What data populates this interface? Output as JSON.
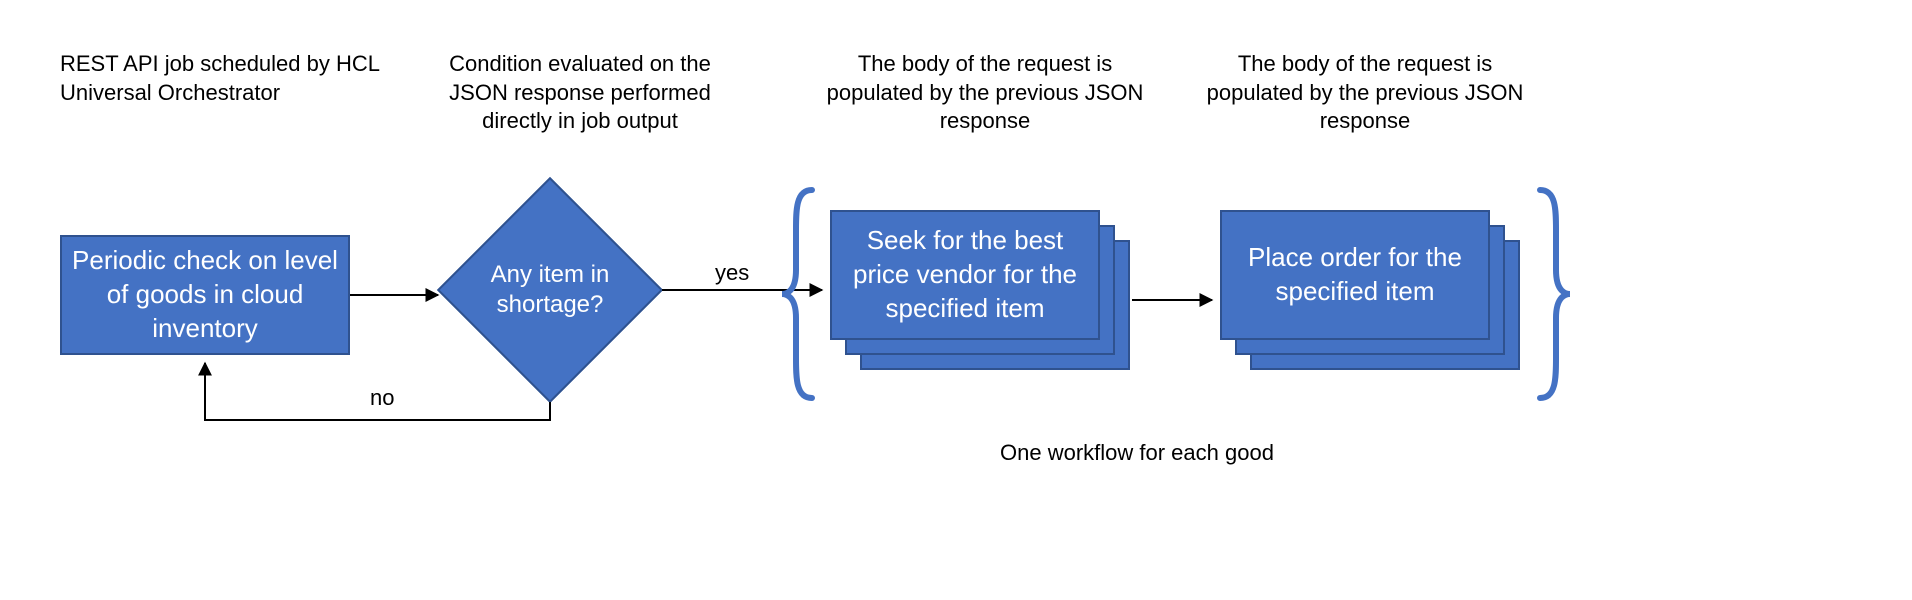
{
  "captions": {
    "c1": "REST API job scheduled by HCL Universal Orchestrator",
    "c2": "Condition evaluated on the JSON response performed directly in job output",
    "c3": "The body of the request is populated by the previous JSON response",
    "c4": "The body of the request is populated by the previous JSON response"
  },
  "nodes": {
    "periodic_check": "Periodic check on level of goods in cloud inventory",
    "decision": "Any item in shortage?",
    "seek_vendor": "Seek for the best price vendor for the specified item",
    "place_order": "Place order for the specified item"
  },
  "edges": {
    "yes": "yes",
    "no": "no"
  },
  "footer": "One workflow for each good",
  "chart_data": {
    "type": "flowchart",
    "nodes": [
      {
        "id": "periodic_check",
        "kind": "process",
        "text": "Periodic check on level of goods in cloud inventory",
        "caption": "REST API job scheduled by HCL Universal Orchestrator"
      },
      {
        "id": "decision",
        "kind": "decision",
        "text": "Any item in shortage?",
        "caption": "Condition evaluated on the JSON response performed directly in job output"
      },
      {
        "id": "seek_vendor",
        "kind": "process_multi",
        "text": "Seek for the best price vendor for the specified item",
        "caption": "The body of the request is populated by the previous JSON response"
      },
      {
        "id": "place_order",
        "kind": "process_multi",
        "text": "Place order for the specified item",
        "caption": "The body of the request is populated by the previous JSON response"
      }
    ],
    "edges": [
      {
        "from": "periodic_check",
        "to": "decision"
      },
      {
        "from": "decision",
        "to": "seek_vendor",
        "label": "yes"
      },
      {
        "from": "decision",
        "to": "periodic_check",
        "label": "no"
      },
      {
        "from": "seek_vendor",
        "to": "place_order"
      }
    ],
    "group": {
      "members": [
        "seek_vendor",
        "place_order"
      ],
      "label": "One workflow for each good",
      "brackets": true
    }
  }
}
